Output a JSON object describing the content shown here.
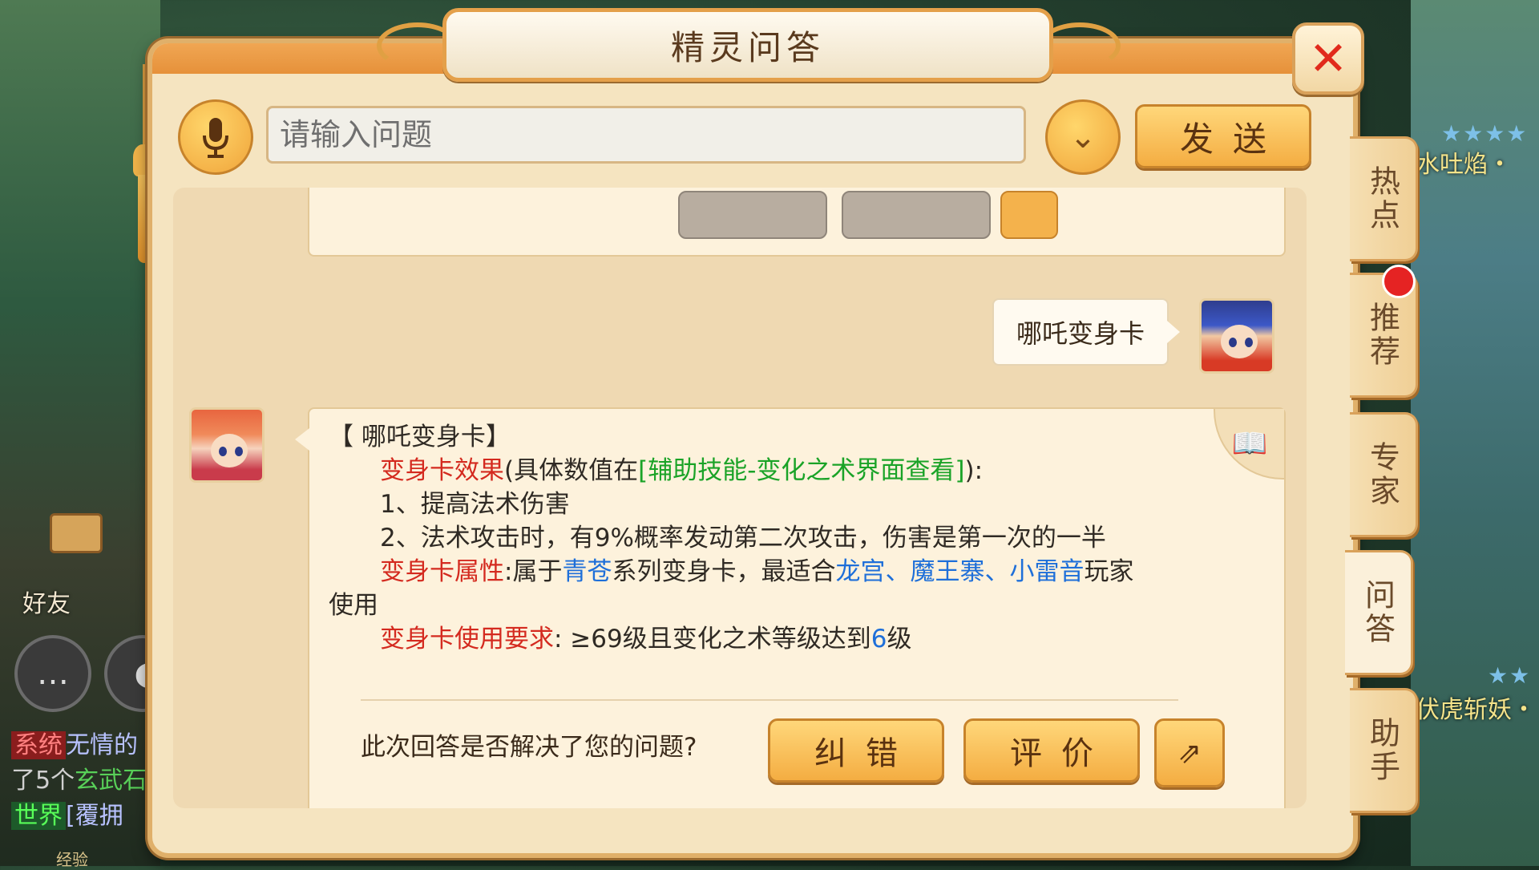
{
  "window": {
    "title": "精灵问答"
  },
  "input": {
    "placeholder": "请输入问题",
    "send_label": "发送"
  },
  "user_message": {
    "text": "哪吒变身卡"
  },
  "answer": {
    "heading": "【 哪吒变身卡】",
    "effect_label": "变身卡效果",
    "effect_paren_open": "(具体数值在",
    "effect_link": "[辅助技能-变化之术界面查看]",
    "effect_paren_close": "):",
    "item1": "1、提高法术伤害",
    "item2": "2、法术攻击时，有9%概率发动第二次攻击，伤害是第一次的一半",
    "attr_label": "变身卡属性",
    "attr_text1": ":属于",
    "attr_series": "青苍",
    "attr_text2": "系列变身卡，最适合",
    "attr_schools": "龙宫、魔王寨、小雷音",
    "attr_text3": "玩家",
    "attr_text4": "使用",
    "req_label": "变身卡使用要求",
    "req_text1": ": ≥69级且变化之术等级达到",
    "req_level": "6",
    "req_text2": "级"
  },
  "feedback": {
    "question": "此次回答是否解决了您的问题?",
    "correct_label": "纠错",
    "rate_label": "评价"
  },
  "side_tabs": [
    "热点",
    "推荐",
    "专家",
    "问答",
    "助手"
  ],
  "active_tab": "问答",
  "background": {
    "friend_label": "好友",
    "chat": [
      {
        "tag": "系统",
        "text": "无情的"
      },
      {
        "tag": "",
        "text": "了5个",
        "extra": "玄武石"
      },
      {
        "tag": "世界",
        "text": "[覆拥"
      }
    ],
    "exp_label": "经验",
    "right_text_top": "水吐焰・",
    "right_text_bottom": "伏虎斩妖・"
  },
  "colors": {
    "accent": "#f4ad42",
    "panel": "#f5e4c0",
    "red_text": "#d42a1f",
    "green_text": "#1aa327",
    "blue_text": "#1e6fd9"
  }
}
